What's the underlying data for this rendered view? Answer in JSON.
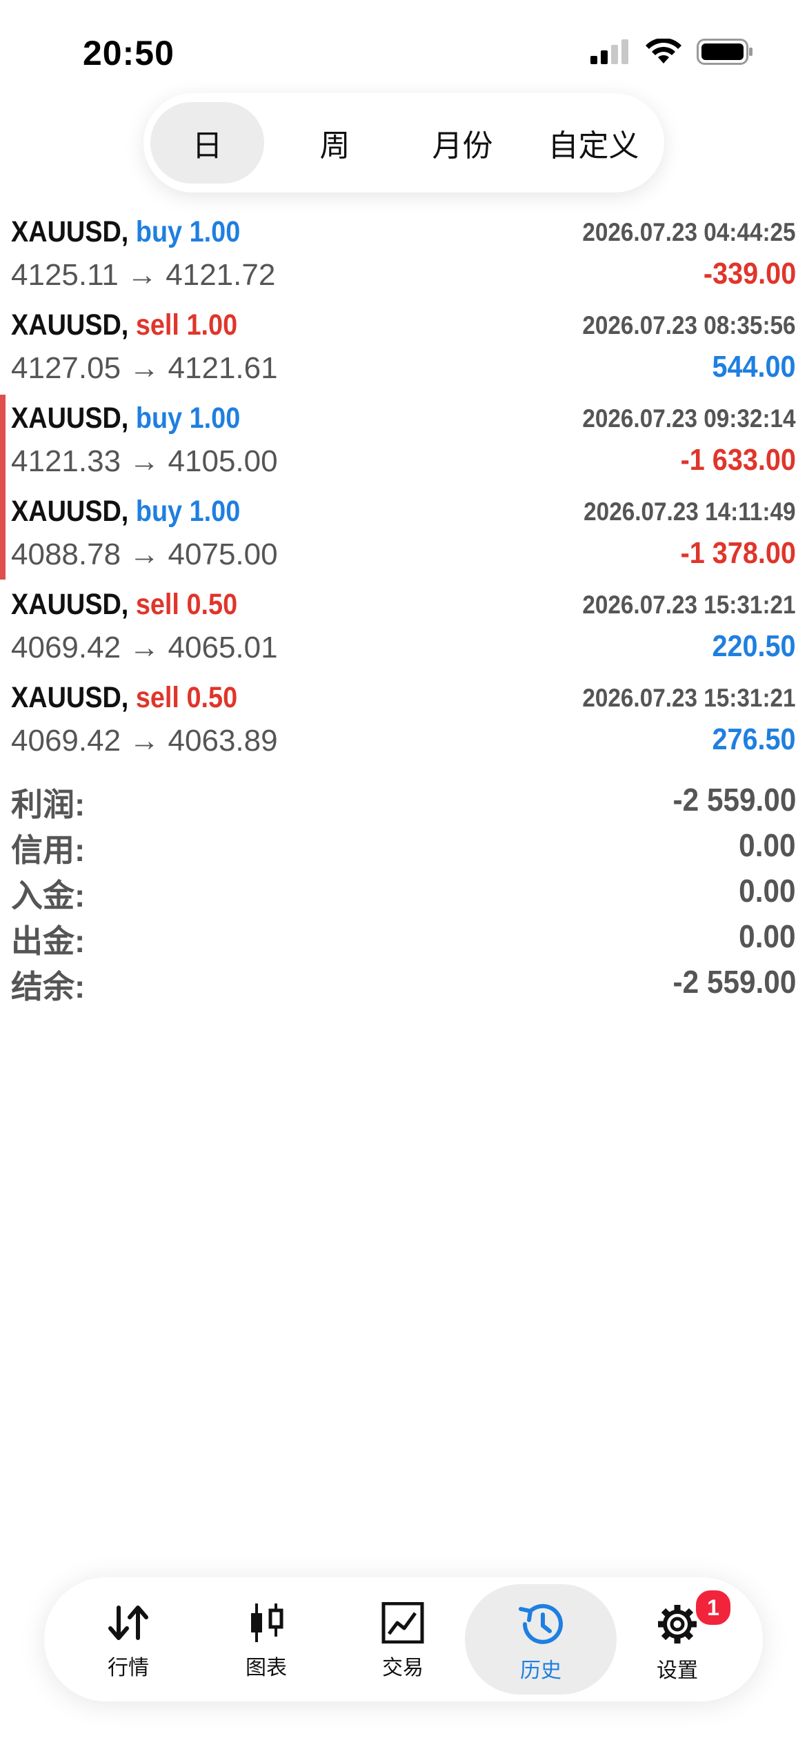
{
  "status_bar": {
    "time": "20:50"
  },
  "segments": [
    {
      "label": "日",
      "active": true
    },
    {
      "label": "周",
      "active": false
    },
    {
      "label": "月份",
      "active": false
    },
    {
      "label": "自定义",
      "active": false
    }
  ],
  "deals": [
    {
      "symbol": "XAUUSD",
      "separator": ",",
      "direction": "buy",
      "volume": "1.00",
      "time": "2026.07.23 04:44:25",
      "open_price": "4125.11",
      "arrow": "→",
      "close_price": "4121.72",
      "profit": "-339.00"
    },
    {
      "symbol": "XAUUSD",
      "separator": ",",
      "direction": "sell",
      "volume": "1.00",
      "time": "2026.07.23 08:35:56",
      "open_price": "4127.05",
      "arrow": "→",
      "close_price": "4121.61",
      "profit": "544.00"
    },
    {
      "symbol": "XAUUSD",
      "separator": ",",
      "direction": "buy",
      "volume": "1.00",
      "time": "2026.07.23 09:32:14",
      "open_price": "4121.33",
      "arrow": "→",
      "close_price": "4105.00",
      "profit": "-1 633.00"
    },
    {
      "symbol": "XAUUSD",
      "separator": ",",
      "direction": "buy",
      "volume": "1.00",
      "time": "2026.07.23 14:11:49",
      "open_price": "4088.78",
      "arrow": "→",
      "close_price": "4075.00",
      "profit": "-1 378.00"
    },
    {
      "symbol": "XAUUSD",
      "separator": ",",
      "direction": "sell",
      "volume": "0.50",
      "time": "2026.07.23 15:31:21",
      "open_price": "4069.42",
      "arrow": "→",
      "close_price": "4065.01",
      "profit": "220.50"
    },
    {
      "symbol": "XAUUSD",
      "separator": ",",
      "direction": "sell",
      "volume": "0.50",
      "time": "2026.07.23 15:31:21",
      "open_price": "4069.42",
      "arrow": "→",
      "close_price": "4063.89",
      "profit": "276.50"
    }
  ],
  "summary": [
    {
      "label": "利润:",
      "value": "-2 559.00"
    },
    {
      "label": "信用:",
      "value": "0.00"
    },
    {
      "label": "入金:",
      "value": "0.00"
    },
    {
      "label": "出金:",
      "value": "0.00"
    },
    {
      "label": "结余:",
      "value": "-2 559.00"
    }
  ],
  "tabbar": {
    "items": [
      {
        "label": "行情",
        "icon": "quotes-arrows-icon"
      },
      {
        "label": "图表",
        "icon": "candlestick-chart-icon"
      },
      {
        "label": "交易",
        "icon": "trade-chart-icon"
      },
      {
        "label": "历史",
        "icon": "history-clock-icon",
        "active": true
      },
      {
        "label": "设置",
        "icon": "settings-gear-icon",
        "badge": "1"
      }
    ]
  },
  "colors": {
    "buy": "#1e7fe0",
    "sell": "#e0352b",
    "accent": "#1e7fe0",
    "badge": "#f2243b",
    "marker": "#e04e4e"
  }
}
